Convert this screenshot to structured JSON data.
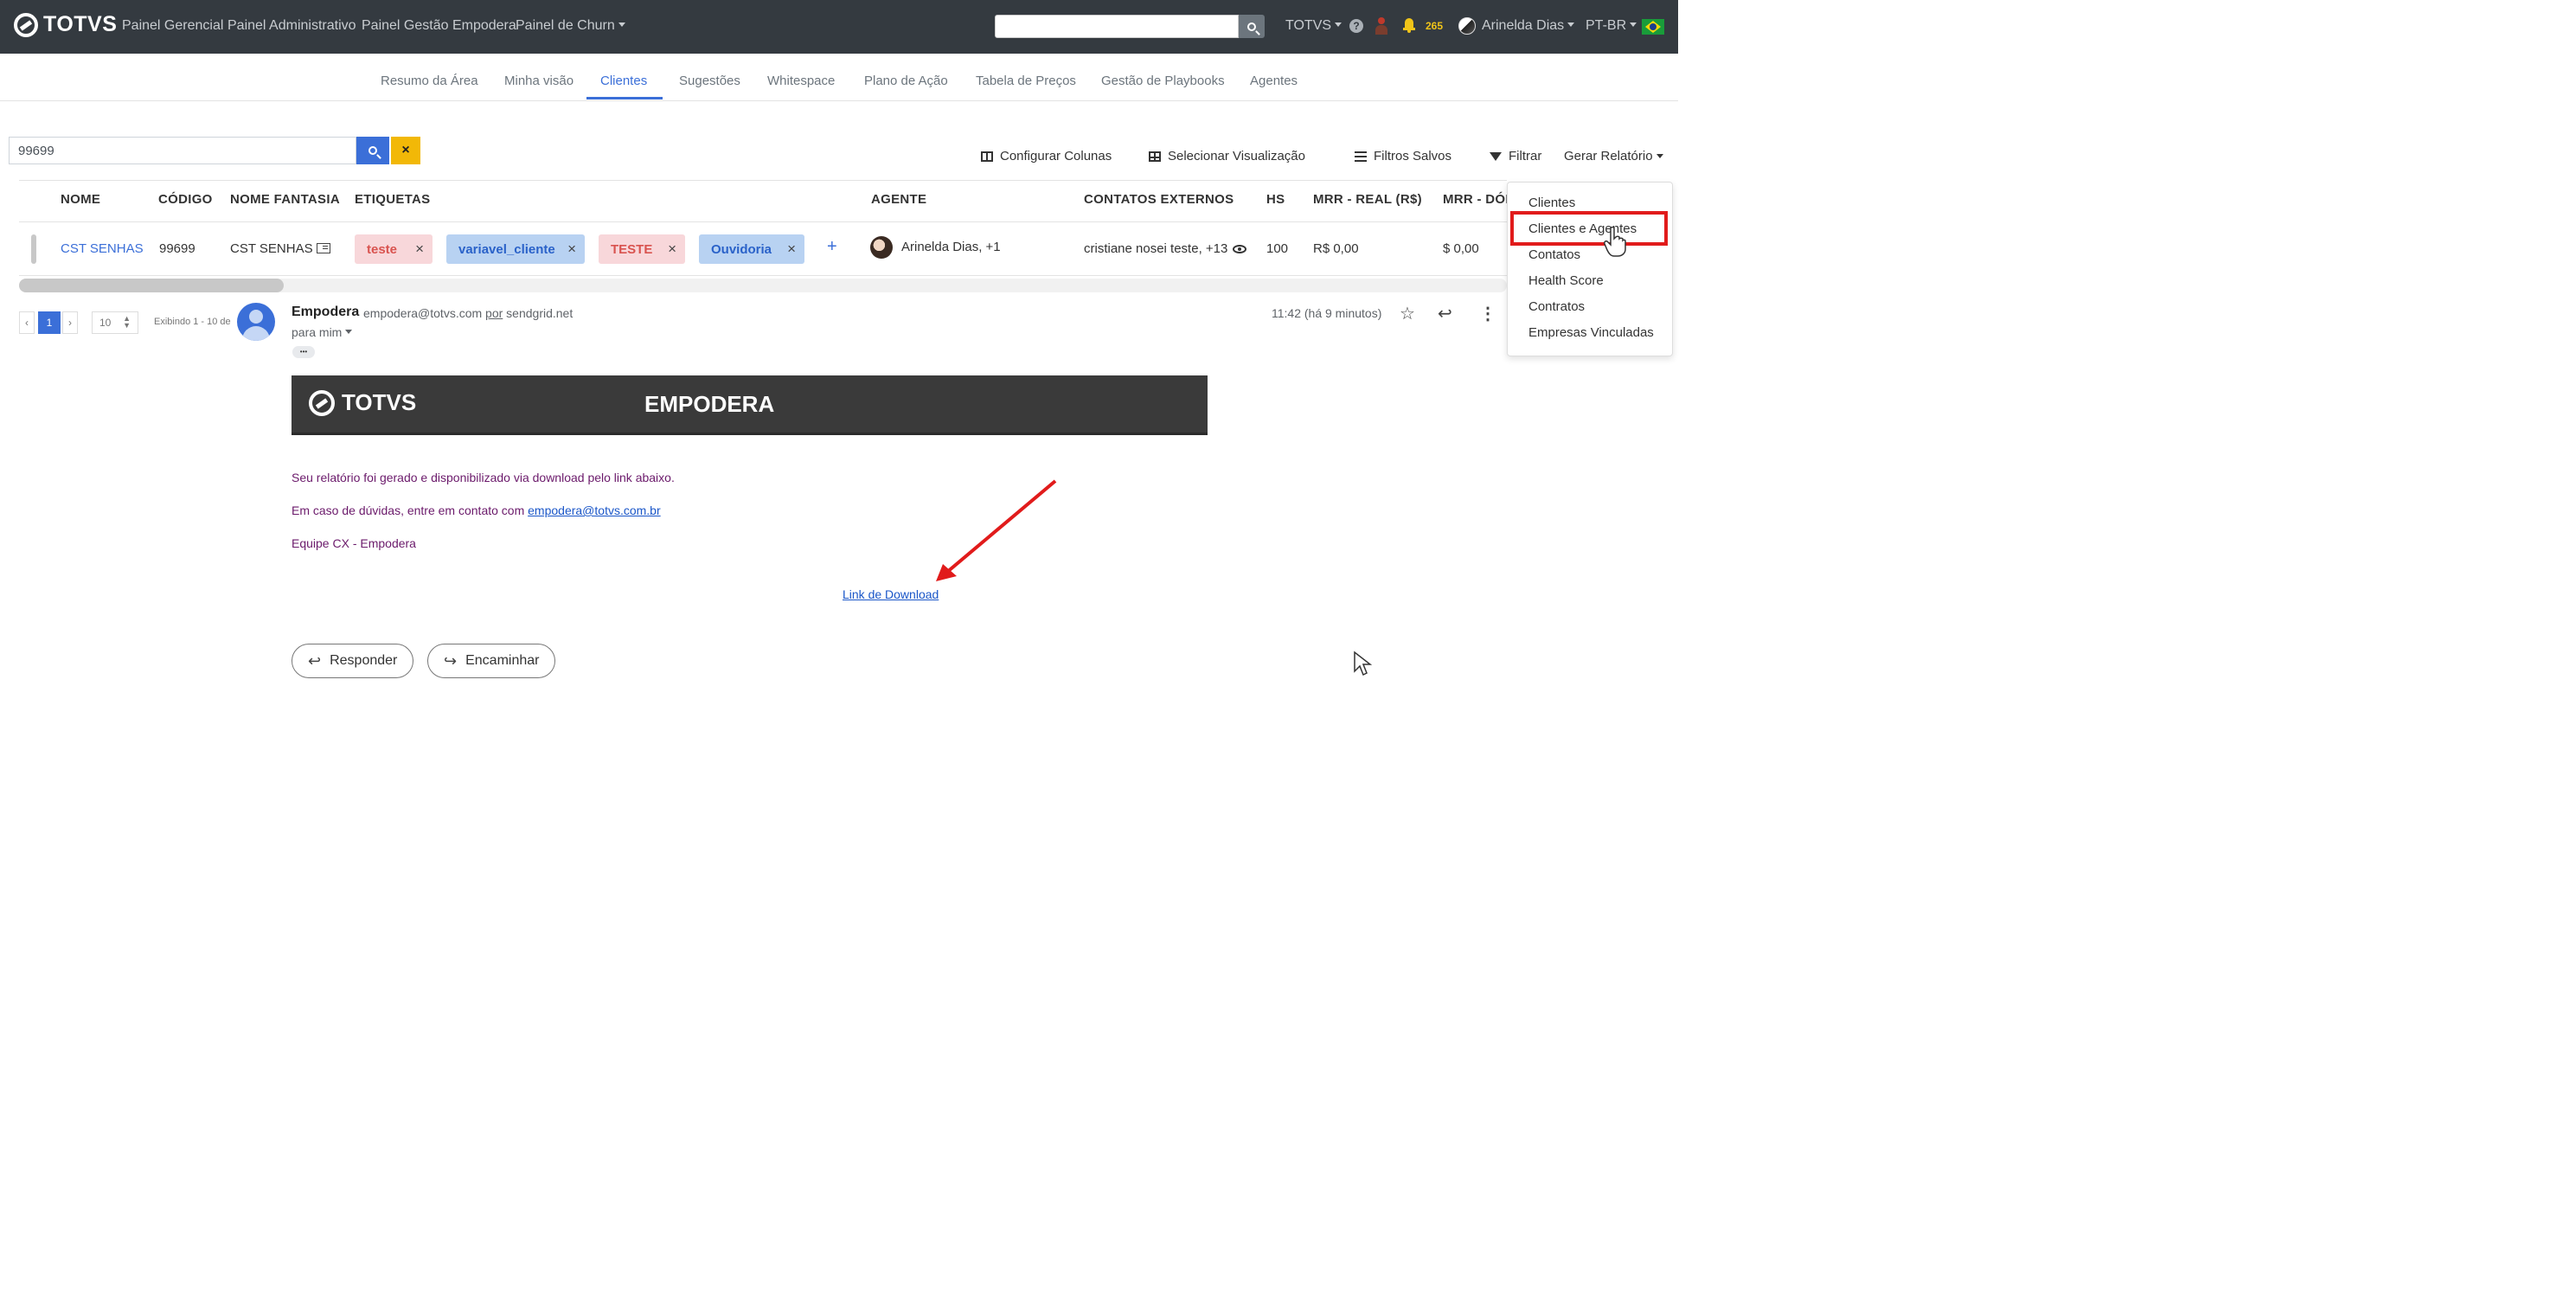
{
  "topnav": {
    "brand": "TOTVS",
    "links": [
      "Painel Gerencial",
      "Painel Administrativo",
      "Painel Gestão Empodera",
      "Painel de Churn"
    ],
    "search_placeholder": "",
    "org": "TOTVS",
    "notification_count": "265",
    "user": "Arinelda Dias",
    "language": "PT-BR"
  },
  "tabs": [
    "Resumo da Área",
    "Minha visão",
    "Clientes",
    "Sugestões",
    "Whitespace",
    "Plano de Ação",
    "Tabela de Preços",
    "Gestão de Playbooks",
    "Agentes"
  ],
  "active_tab": "Clientes",
  "search": {
    "value": "99699",
    "clear_label": "×"
  },
  "toolbar": {
    "configurar": "Configurar Colunas",
    "visualizacao": "Selecionar Visualização",
    "filtros_salvos": "Filtros Salvos",
    "filtrar": "Filtrar",
    "gerar_relatorio": "Gerar Relatório"
  },
  "table": {
    "headers": [
      "NOME",
      "CÓDIGO",
      "NOME FANTASIA",
      "ETIQUETAS",
      "AGENTE",
      "CONTATOS EXTERNOS",
      "HS",
      "MRR - REAL (R$)",
      "MRR - DÓL"
    ],
    "row": {
      "nome": "CST SENHAS",
      "codigo": "99699",
      "fantasia": "CST SENHAS",
      "tags": [
        "teste",
        "variavel_cliente",
        "TESTE",
        "Ouvidoria"
      ],
      "add": "+",
      "agente": "Arinelda Dias, +1",
      "contatos": "cristiane nosei teste, +13",
      "hs": "100",
      "mrr_real": "R$ 0,00",
      "mrr_dolar": "$ 0,00"
    }
  },
  "pagination": {
    "prev": "‹",
    "page": "1",
    "next": "›",
    "page_size": "10",
    "info": "Exibindo 1 - 10 de"
  },
  "report_menu": {
    "items": [
      "Clientes",
      "Clientes e Agentes",
      "Contatos",
      "Health Score",
      "Contratos",
      "Empresas Vinculadas"
    ],
    "highlighted": "Clientes e Agentes",
    "highlight_color": "#e11b1b"
  },
  "email": {
    "sender_name": "Empodera",
    "sender_email": "empodera@totvs.com",
    "via_label": "por",
    "via": "sendgrid.net",
    "to": "para mim",
    "time": "11:42 (há 9 minutos)",
    "ellipsis": "•••",
    "banner_brand": "TOTVS",
    "banner_title": "EMPODERA",
    "line1": "Seu relatório foi gerado e disponibilizado via download pelo link abaixo.",
    "line2_prefix": "Em caso de dúvidas, entre em contato com ",
    "line2_link": "empodera@totvs.com.br",
    "line3": "Equipe CX - Empodera",
    "download_link": "Link de Download",
    "reply": "Responder",
    "forward": "Encaminhar"
  },
  "colors": {
    "navbar": "#343a40",
    "accent": "#3b6fd8",
    "warning": "#f2b807",
    "annotation": "#e11b1b"
  }
}
